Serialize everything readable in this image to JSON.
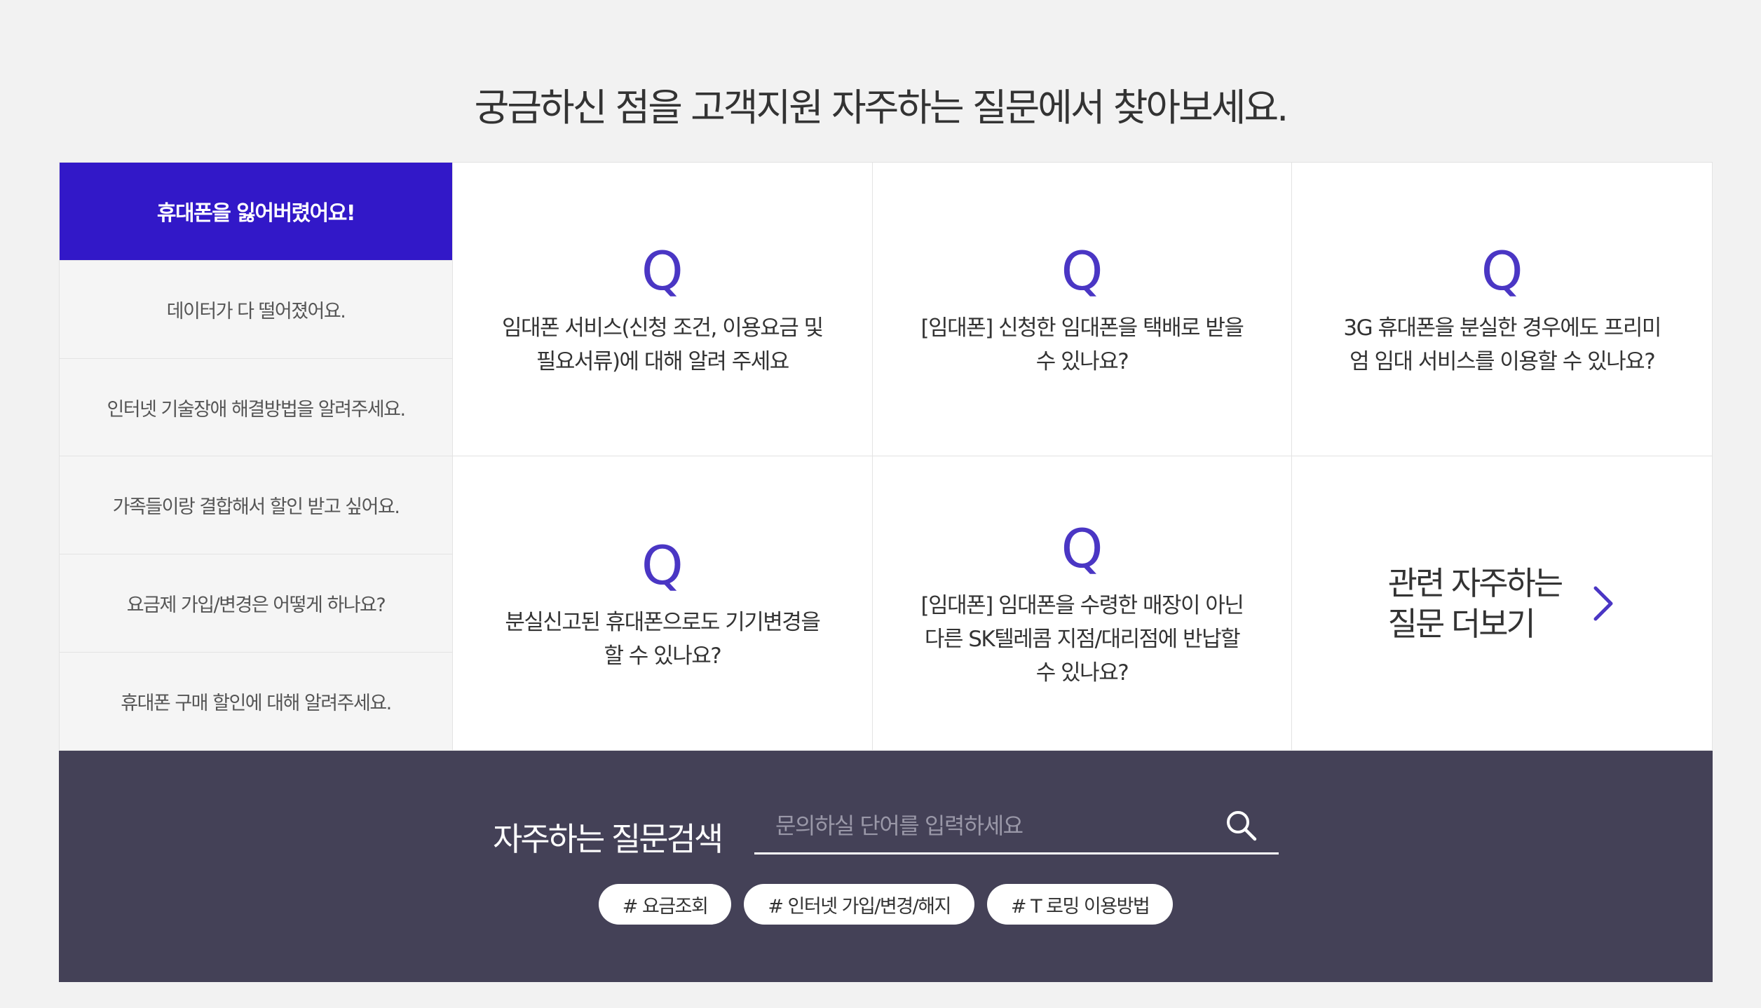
{
  "header": {
    "title": "궁금하신 점을 고객지원 자주하는 질문에서 찾아보세요."
  },
  "categories": [
    {
      "label": "휴대폰을 잃어버렸어요!",
      "active": true
    },
    {
      "label": "데이터가 다 떨어졌어요."
    },
    {
      "label": "인터넷 기술장애 해결방법을 알려주세요."
    },
    {
      "label": "가족들이랑 결합해서 할인 받고 싶어요."
    },
    {
      "label": "요금제 가입/변경은 어떻게 하나요?"
    },
    {
      "label": "휴대폰 구매 할인에 대해 알려주세요."
    }
  ],
  "questions": [
    {
      "mark": "Q",
      "text": "임대폰 서비스(신청 조건, 이용요금 및 필요서류)에 대해 알려 주세요"
    },
    {
      "mark": "Q",
      "text": "[임대폰] 신청한 임대폰을 택배로 받을 수 있나요?"
    },
    {
      "mark": "Q",
      "text": "3G 휴대폰을 분실한 경우에도 프리미엄 임대 서비스를 이용할 수 있나요?"
    },
    {
      "mark": "Q",
      "text": "분실신고된 휴대폰으로도 기기변경을 할 수 있나요?"
    },
    {
      "mark": "Q",
      "text": "[임대폰] 임대폰을 수령한 매장이 아닌 다른 SK텔레콤 지점/대리점에 반납할 수 있나요?"
    }
  ],
  "more": {
    "label": "관련 자주하는 질문 더보기",
    "icon": "chevron-right-icon",
    "color": "#4a36c4"
  },
  "search": {
    "label": "자주하는 질문검색",
    "placeholder": "문의하실 단어를 입력하세요",
    "value": "",
    "icon": "search-icon"
  },
  "tags": [
    {
      "label": "# 요금조회"
    },
    {
      "label": "# 인터넷 가입/변경/해지"
    },
    {
      "label": "# T 로밍 이용방법"
    }
  ],
  "colors": {
    "accent": "#3218c8",
    "search_background": "#444157",
    "page_background": "#f2f2f2"
  }
}
